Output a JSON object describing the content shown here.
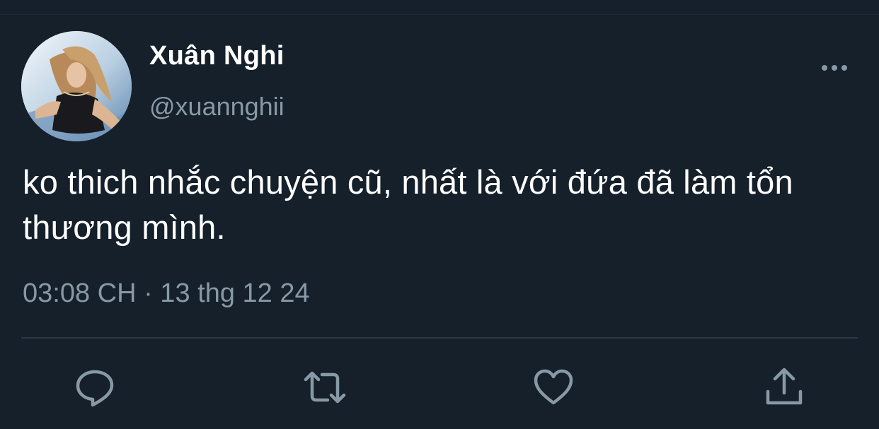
{
  "tweet": {
    "display_name": "Xuân Nghi",
    "handle": "@xuannghii",
    "text": "ko thich nhắc chuyện cũ, nhất là với đứa đã làm tổn thương mình.",
    "timestamp": "03:08 CH · 13 thg 12 24"
  },
  "icons": {
    "more": "more-horizontal-icon",
    "reply": "reply-bubble-icon",
    "retweet": "retweet-icon",
    "like": "heart-icon",
    "share": "share-upload-icon"
  },
  "colors": {
    "background": "#15202b",
    "primary_text": "#ffffff",
    "secondary_text": "#8899a6",
    "divider": "#2b3845"
  }
}
